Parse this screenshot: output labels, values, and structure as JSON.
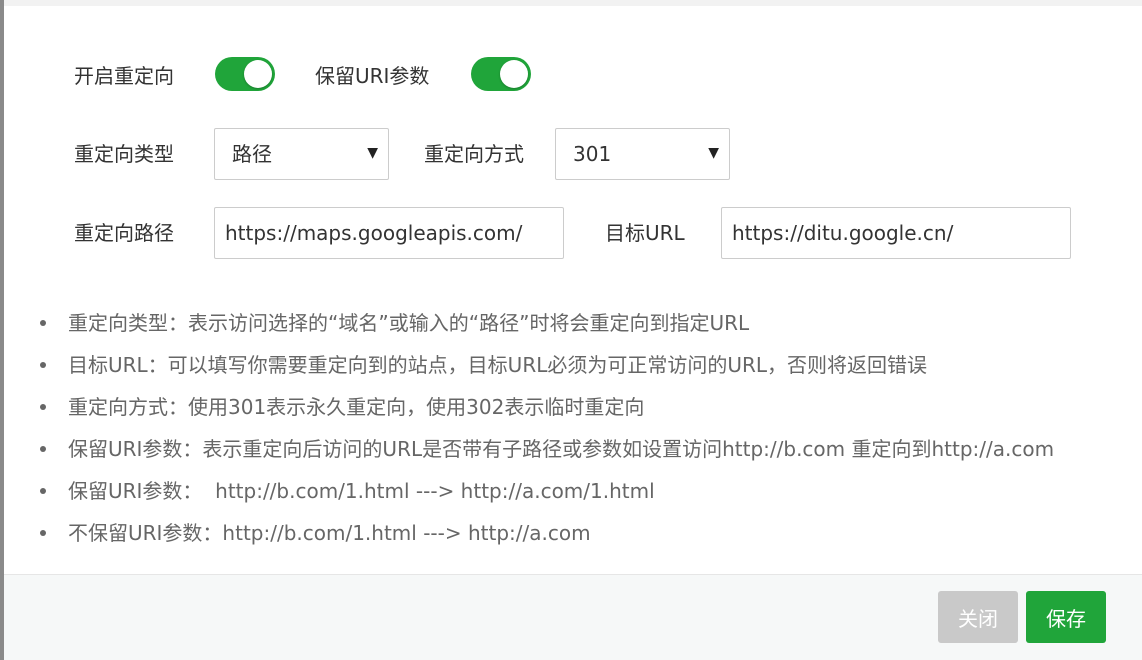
{
  "form": {
    "redirect_enable_label": "开启重定向",
    "redirect_enable_on": true,
    "keep_uri_label": "保留URI参数",
    "keep_uri_on": true,
    "redirect_type_label": "重定向类型",
    "redirect_type_value": "路径",
    "redirect_method_label": "重定向方式",
    "redirect_method_value": "301",
    "redirect_path_label": "重定向路径",
    "redirect_path_value": "https://maps.googleapis.com/",
    "target_url_label": "目标URL",
    "target_url_value": "https://ditu.google.cn/"
  },
  "notes": [
    "重定向类型：表示访问选择的“域名”或输入的“路径”时将会重定向到指定URL",
    "目标URL：可以填写你需要重定向到的站点，目标URL必须为可正常访问的URL，否则将返回错误",
    "重定向方式：使用301表示永久重定向，使用302表示临时重定向",
    "保留URI参数：表示重定向后访问的URL是否带有子路径或参数如设置访问http://b.com 重定向到http://a.com",
    "保留URI参数：  http://b.com/1.html ---> http://a.com/1.html",
    "不保留URI参数：http://b.com/1.html ---> http://a.com"
  ],
  "footer": {
    "close_label": "关闭",
    "save_label": "保存"
  },
  "colors": {
    "accent": "#20a53a",
    "disabled_button": "#c9c9c9"
  }
}
